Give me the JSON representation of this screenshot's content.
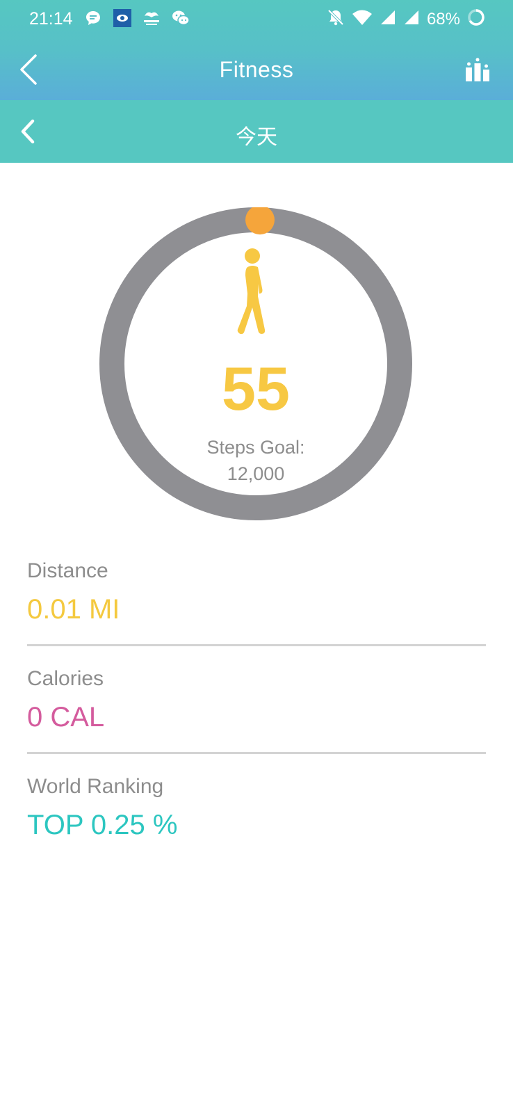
{
  "status_bar": {
    "time": "21:14",
    "battery": "68%",
    "left_icons": [
      "chat-bubble-icon",
      "app-icon",
      "news-icon",
      "wechat-icon"
    ],
    "right_icons": [
      "notifications-muted-icon",
      "wifi-icon",
      "signal-icon",
      "signal-icon",
      "battery-ring-icon"
    ]
  },
  "header": {
    "title": "Fitness",
    "back_icon": "chevron-left-icon",
    "ranking_icon": "podium-icon"
  },
  "date_nav": {
    "label": "今天",
    "prev_icon": "chevron-left-icon"
  },
  "steps": {
    "value": "55",
    "goal_label": "Steps Goal:",
    "goal_value": "12,000",
    "progress_fraction": 0.0046,
    "icon": "walking-person-icon"
  },
  "stats": [
    {
      "label": "Distance",
      "value": "0.01 MI"
    },
    {
      "label": "Calories",
      "value": "0 CAL"
    },
    {
      "label": "World Ranking",
      "value": "TOP 0.25 %"
    }
  ],
  "colors": {
    "header_teal": "#56c7c1",
    "header_blue": "#5aaed8",
    "ring_gray": "#8f8f93",
    "ring_indicator": "#f5a53b",
    "steps_yellow": "#f7c843",
    "distance": "#f4c93f",
    "calories": "#d45b9d",
    "ranking": "#2cc6c0"
  }
}
